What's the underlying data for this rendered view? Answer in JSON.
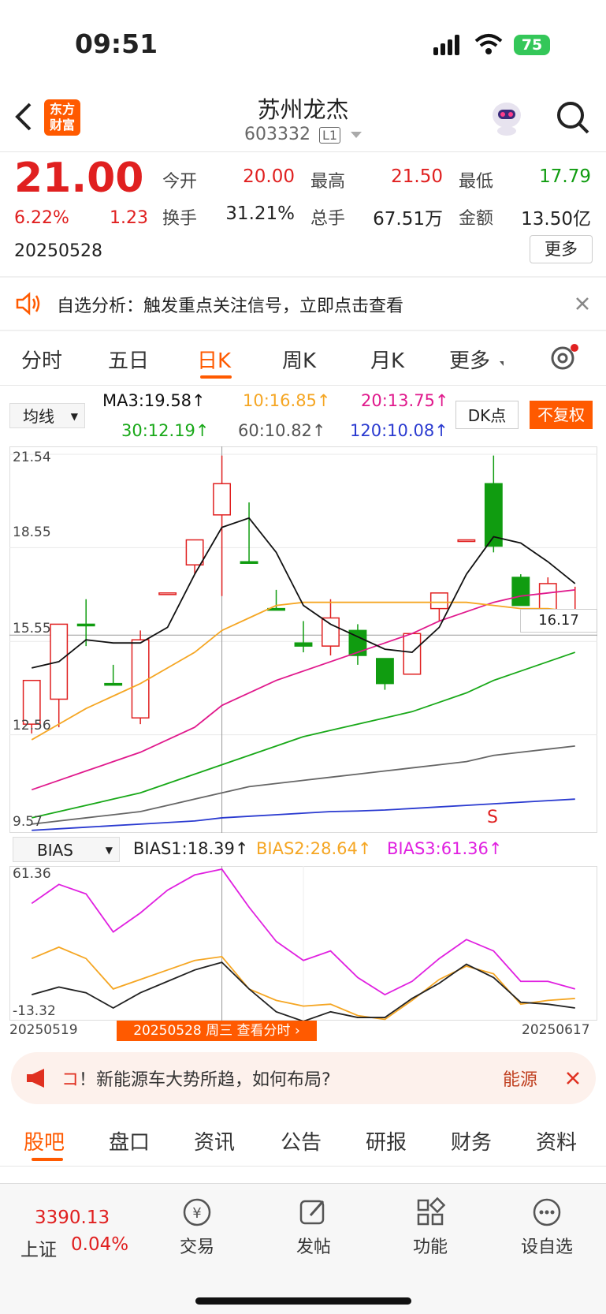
{
  "status": {
    "time": "09:51",
    "battery": "75"
  },
  "header": {
    "logo": "东方\n财富",
    "title": "苏州龙杰",
    "code": "603332",
    "level": "L1"
  },
  "quote": {
    "price": "21.00",
    "change_pct": "6.22%",
    "change": "1.23",
    "date": "20250528",
    "open_label": "今开",
    "open": "20.00",
    "high_label": "最高",
    "high": "21.50",
    "low_label": "最低",
    "low": "17.79",
    "turnover_label": "换手",
    "turnover": "31.21%",
    "volume_label": "总手",
    "volume": "67.51万",
    "amount_label": "金额",
    "amount": "13.50亿",
    "more": "更多"
  },
  "notice": {
    "text": "自选分析：触发重点关注信号，立即点击查看"
  },
  "chart_tabs": [
    "分时",
    "五日",
    "日K",
    "周K",
    "月K",
    "更多"
  ],
  "indicator": {
    "ma_select": "均线",
    "ma3": "MA3:19.58↑",
    "ma10": "10:16.85↑",
    "ma20": "20:13.75↑",
    "ma30": "30:12.19↑",
    "ma60": "60:10.82↑",
    "ma120": "120:10.08↑",
    "dk": "DK点",
    "fq": "不复权",
    "bias_select": "BIAS",
    "bias1": "BIAS1:18.39↑",
    "bias2": "BIAS2:28.64↑",
    "bias3": "BIAS3:61.36↑"
  },
  "colors": {
    "up": "#e02020",
    "down": "#109c10",
    "ma3": "#111111",
    "ma10": "#f5a623",
    "ma20": "#e0198c",
    "ma30": "#18a818",
    "ma60": "#666666",
    "ma120": "#2a3ad0",
    "accent": "#ff5a00"
  },
  "chart_data": {
    "type": "candlestick",
    "x_start": "20250519",
    "x_end": "20250617",
    "y_ticks": [
      "21.54",
      "18.55",
      "15.55",
      "12.56",
      "9.57"
    ],
    "cursor_price": "16.17",
    "cursor_date": "20250528 周三 查看分时",
    "signal": "S",
    "candles": [
      {
        "o": 12.9,
        "c": 14.3,
        "h": 14.3,
        "l": 12.6,
        "up": true
      },
      {
        "o": 13.7,
        "c": 16.1,
        "h": 16.1,
        "l": 12.8,
        "up": true
      },
      {
        "o": 16.1,
        "c": 16.1,
        "h": 16.9,
        "l": 15.4,
        "up": false
      },
      {
        "o": 14.2,
        "c": 14.2,
        "h": 14.8,
        "l": 14.2,
        "up": false
      },
      {
        "o": 13.1,
        "c": 15.6,
        "h": 15.9,
        "l": 12.9,
        "up": true
      },
      {
        "o": 17.1,
        "c": 17.1,
        "h": 17.1,
        "l": 17.1,
        "up": true
      },
      {
        "o": 18.0,
        "c": 18.8,
        "h": 18.8,
        "l": 17.7,
        "up": true
      },
      {
        "o": 19.6,
        "c": 20.6,
        "h": 21.5,
        "l": 17.0,
        "up": true
      },
      {
        "o": 18.1,
        "c": 18.1,
        "h": 20.0,
        "l": 18.1,
        "up": false
      },
      {
        "o": 16.6,
        "c": 16.6,
        "h": 17.2,
        "l": 16.6,
        "up": false
      },
      {
        "o": 15.5,
        "c": 15.4,
        "h": 16.2,
        "l": 15.2,
        "up": false
      },
      {
        "o": 15.4,
        "c": 16.3,
        "h": 16.9,
        "l": 15.1,
        "up": true
      },
      {
        "o": 15.9,
        "c": 15.1,
        "h": 16.1,
        "l": 14.8,
        "up": false
      },
      {
        "o": 15.0,
        "c": 14.2,
        "h": 15.0,
        "l": 14.0,
        "up": false
      },
      {
        "o": 14.5,
        "c": 15.8,
        "h": 15.8,
        "l": 14.5,
        "up": true
      },
      {
        "o": 16.6,
        "c": 17.1,
        "h": 17.1,
        "l": 16.2,
        "up": true
      },
      {
        "o": 18.8,
        "c": 18.8,
        "h": 18.8,
        "l": 18.8,
        "up": true
      },
      {
        "o": 20.6,
        "c": 18.6,
        "h": 21.5,
        "l": 18.4,
        "up": false
      },
      {
        "o": 17.6,
        "c": 16.7,
        "h": 17.7,
        "l": 16.7,
        "up": false
      },
      {
        "o": 16.2,
        "c": 17.4,
        "h": 17.6,
        "l": 16.2,
        "up": true
      },
      {
        "o": 16.5,
        "c": 16.5,
        "h": 17.3,
        "l": 16.2,
        "up": true
      }
    ],
    "ma3": [
      14.7,
      14.9,
      15.6,
      15.5,
      15.5,
      16.0,
      17.7,
      19.2,
      19.5,
      18.4,
      16.7,
      16.1,
      15.7,
      15.3,
      15.2,
      16.0,
      17.7,
      18.9,
      18.7,
      18.1,
      17.4
    ],
    "ma10": [
      12.4,
      12.9,
      13.4,
      13.8,
      14.2,
      14.7,
      15.2,
      15.9,
      16.3,
      16.7,
      16.8,
      16.8,
      16.8,
      16.8,
      16.8,
      16.8,
      16.8,
      16.7,
      16.6,
      16.6,
      16.5
    ],
    "ma20": [
      10.8,
      11.1,
      11.4,
      11.7,
      12.0,
      12.4,
      12.8,
      13.5,
      13.9,
      14.3,
      14.6,
      14.9,
      15.2,
      15.5,
      15.8,
      16.2,
      16.5,
      16.8,
      17.0,
      17.1,
      17.2
    ],
    "ma30": [
      9.9,
      10.1,
      10.3,
      10.5,
      10.7,
      11.0,
      11.3,
      11.6,
      11.9,
      12.2,
      12.5,
      12.7,
      12.9,
      13.1,
      13.3,
      13.6,
      13.9,
      14.3,
      14.6,
      14.9,
      15.2
    ],
    "ma60": [
      9.7,
      9.8,
      9.9,
      10.0,
      10.1,
      10.3,
      10.5,
      10.7,
      10.9,
      11.0,
      11.1,
      11.2,
      11.3,
      11.4,
      11.5,
      11.6,
      11.7,
      11.9,
      12.0,
      12.1,
      12.2
    ],
    "ma120": [
      9.5,
      9.55,
      9.6,
      9.65,
      9.7,
      9.75,
      9.8,
      9.9,
      9.95,
      10.0,
      10.05,
      10.1,
      10.12,
      10.15,
      10.2,
      10.25,
      10.3,
      10.35,
      10.4,
      10.45,
      10.5
    ],
    "bias_ticks": [
      "61.36",
      "-13.32"
    ],
    "bias1": [
      -3,
      1,
      -2,
      -10,
      -2,
      4,
      10,
      14,
      0,
      -12,
      -17,
      -12,
      -15,
      -15,
      -5,
      3,
      13,
      6,
      -7,
      -8,
      -10
    ],
    "bias2": [
      16,
      22,
      16,
      0,
      5,
      10,
      15,
      17,
      0,
      -6,
      -9,
      -8,
      -14,
      -16,
      -6,
      5,
      12,
      8,
      -8,
      -6,
      -5
    ],
    "bias3": [
      45,
      55,
      50,
      30,
      40,
      52,
      60,
      63,
      43,
      25,
      15,
      20,
      6,
      -3,
      4,
      16,
      26,
      20,
      4,
      4,
      0
    ]
  },
  "ad": {
    "text": "！新能源车大势所趋，如何布局?",
    "tag": "能源"
  },
  "bottom_tabs": [
    "股吧",
    "盘口",
    "资讯",
    "公告",
    "研报",
    "财务",
    "资料"
  ],
  "footer": {
    "index_value": "3390.13",
    "index_name": "上证",
    "index_change": "0.04%",
    "trade": "交易",
    "post": "发帖",
    "func": "功能",
    "add": "设自选"
  }
}
